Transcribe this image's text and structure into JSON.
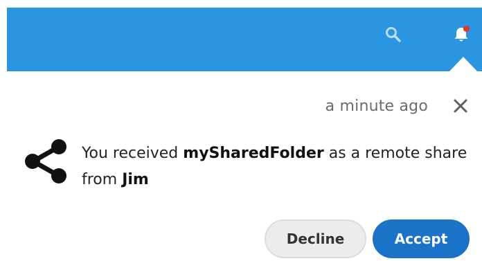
{
  "header": {
    "background_color": "#2a95e0",
    "search_icon": "search-icon",
    "notifications_icon": "bell-icon",
    "notification_dot_color": "#e9322d"
  },
  "notification": {
    "timestamp": "a minute ago",
    "close_icon": "close-icon",
    "share_icon": "share-icon",
    "message": {
      "part1": "You received ",
      "folder_name": "mySharedFolder",
      "part2": " as a remote share from ",
      "sender": "Jim"
    },
    "decline_label": "Decline",
    "accept_label": "Accept",
    "accept_color": "#1a73c9"
  }
}
